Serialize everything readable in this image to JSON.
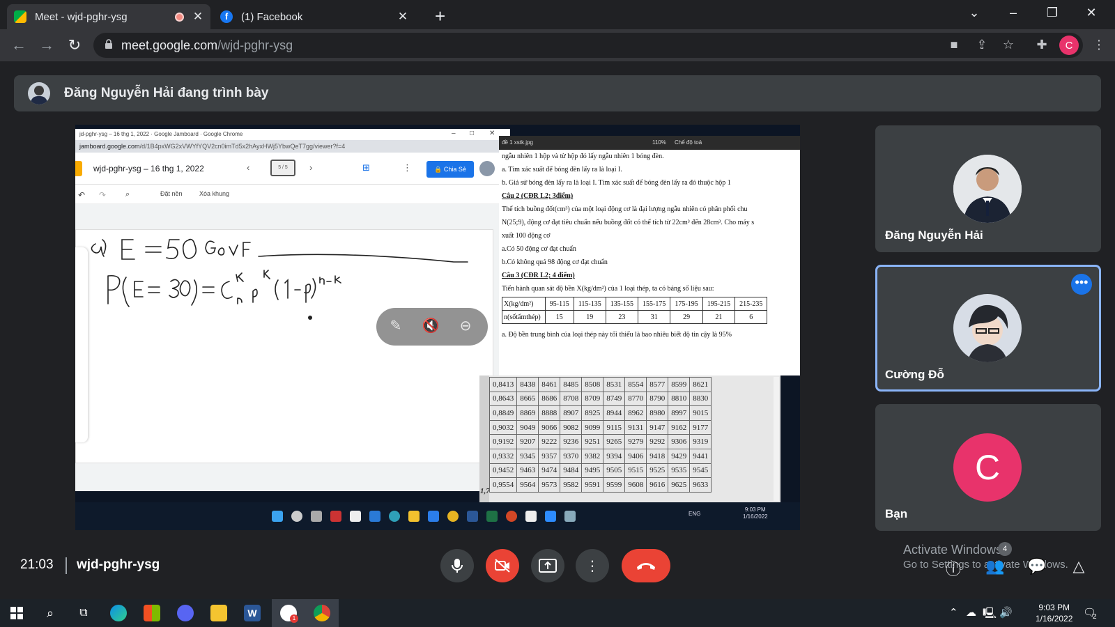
{
  "browser": {
    "tabs": [
      {
        "title": "Meet - wjd-pghr-ysg",
        "active": true
      },
      {
        "title": "(1) Facebook",
        "active": false
      }
    ],
    "url_host": "meet.google.com",
    "url_path": "/wjd-pghr-ysg",
    "profile_initial": "C"
  },
  "meet": {
    "presenter_banner": "Đăng Nguyễn Hải đang trình bày",
    "time": "21:03",
    "meeting_code": "wjd-pghr-ysg",
    "participant_count": "4",
    "watermark_line1": "Activate Windows",
    "watermark_line2": "Go to Settings to activate Windows."
  },
  "participants": [
    {
      "name": "Đăng Nguyễn Hải",
      "selected": false
    },
    {
      "name": "Cường Đỗ",
      "selected": true
    },
    {
      "name": "Bạn",
      "initial": "C",
      "avatar_color": "#e8336b",
      "selected": false
    }
  ],
  "shared": {
    "jam_window_title": "jd-pghr-ysg – 16 thg 1, 2022 · Google Jamboard · Google Chrome",
    "jam_url_host": "jamboard.google.com",
    "jam_url_path": "/d/1B4pxWG2xVWYfYQV2cn0imTd5x2hAyxHWj5YbwQeT7gg/viewer?f=4",
    "jam_doc_title": "wjd-pghr-ysg – 16 thg 1, 2022",
    "jam_frame_counter": "5 / 5",
    "jam_share": "Chia Sẻ",
    "jam_tool_bg": "Đặt nền",
    "jam_tool_clear": "Xóa khung",
    "doc_window_title": "đề 1 xstk.jpg",
    "doc_zoom": "110%",
    "doc_fullscreen": "Chế độ toả",
    "doc_lines": [
      "ngẫu nhiên 1 hộp và từ hộp đó lấy ngẫu nhiên 1 bóng đèn.",
      "a. Tìm xác suất để bóng đèn lấy ra là loại I.",
      "b. Giả sử bóng đèn lấy ra là loại I. Tìm xác suất để bóng đèn lấy ra đó thuộc hộp 1"
    ],
    "q2_title": "Câu 2 (CĐR L2; 3điểm)",
    "q2_lines": [
      "Thể tích buồng đốt(cm³) của một loại động cơ là đại lượng ngẫu nhiên có phân phối chu",
      "N(25;9), động cơ đạt tiêu chuẩn nếu buồng đốt có thể tích từ 22cm³ đến 28cm³. Cho máy s",
      "xuất 100 động cơ",
      "a.Có 50 động cơ đạt chuẩn",
      "b.Có không quá 98 động cơ đạt chuẩn"
    ],
    "q3_title": "Câu 3 (CĐR L2; 4 điểm)",
    "q3_line": "Tiến hành quan sát độ bền X(kg/dm²) của 1 loại thép, ta có bảng số liệu sau:",
    "q3_table": {
      "row1": [
        "X(kg/dm²)",
        "95-115",
        "115-135",
        "135-155",
        "155-175",
        "175-195",
        "195-215",
        "215-235"
      ],
      "row2": [
        "n(sốtấmthép)",
        "15",
        "19",
        "23",
        "31",
        "29",
        "21",
        "6"
      ]
    },
    "q3_a": "a. Độ bền trung bình của loại thép này tối thiểu là bao nhiêu biết độ tin cậy là 95%",
    "z_table": [
      [
        "0,8413",
        "8438",
        "8461",
        "8485",
        "8508",
        "8531",
        "8554",
        "8577",
        "8599",
        "8621"
      ],
      [
        "0,8643",
        "8665",
        "8686",
        "8708",
        "8709",
        "8749",
        "8770",
        "8790",
        "8810",
        "8830"
      ],
      [
        "0,8849",
        "8869",
        "8888",
        "8907",
        "8925",
        "8944",
        "8962",
        "8980",
        "8997",
        "9015"
      ],
      [
        "0,9032",
        "9049",
        "9066",
        "9082",
        "9099",
        "9115",
        "9131",
        "9147",
        "9162",
        "9177"
      ],
      [
        "0,9192",
        "9207",
        "9222",
        "9236",
        "9251",
        "9265",
        "9279",
        "9292",
        "9306",
        "9319"
      ],
      [
        "0,9332",
        "9345",
        "9357",
        "9370",
        "9382",
        "9394",
        "9406",
        "9418",
        "9429",
        "9441"
      ],
      [
        "0,9452",
        "9463",
        "9474",
        "9484",
        "9495",
        "9505",
        "9515",
        "9525",
        "9535",
        "9545"
      ],
      [
        "0,9554",
        "9564",
        "9573",
        "9582",
        "9591",
        "9599",
        "9608",
        "9616",
        "9625",
        "9633"
      ]
    ],
    "z_row_label": "1,7",
    "inner_tray_lang": "ENG",
    "inner_clock_time": "9:03 PM",
    "inner_clock_date": "1/16/2022"
  },
  "taskbar": {
    "clock_time": "9:03 PM",
    "clock_date": "1/16/2022",
    "zalo_badge": "1",
    "notification_count": "2"
  }
}
